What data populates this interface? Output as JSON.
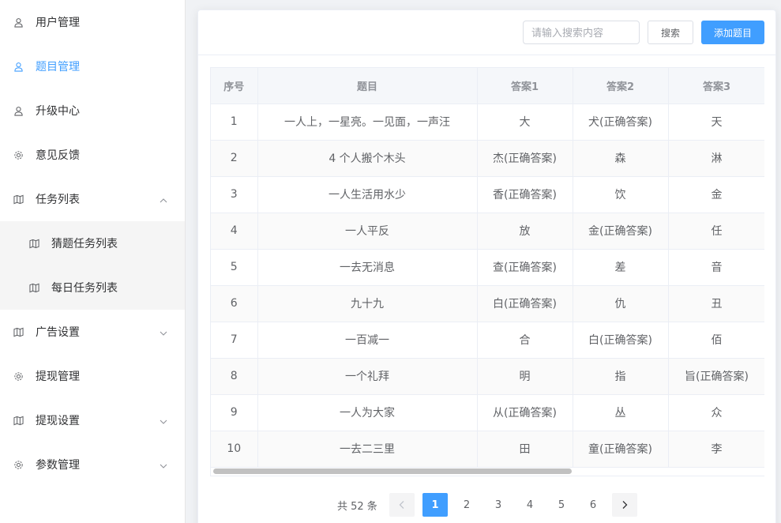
{
  "sidebar": {
    "items": [
      {
        "label": "用户管理",
        "icon": "user-icon"
      },
      {
        "label": "题目管理",
        "icon": "user-icon",
        "active": true
      },
      {
        "label": "升级中心",
        "icon": "user-icon"
      },
      {
        "label": "意见反馈",
        "icon": "gear-icon"
      },
      {
        "label": "任务列表",
        "icon": "map-icon",
        "expanded": true
      },
      {
        "label": "猜题任务列表",
        "icon": "map-icon",
        "sub": true
      },
      {
        "label": "每日任务列表",
        "icon": "map-icon",
        "sub": true
      },
      {
        "label": "广告设置",
        "icon": "map-icon",
        "collapsible": true
      },
      {
        "label": "提现管理",
        "icon": "gear-icon"
      },
      {
        "label": "提现设置",
        "icon": "map-icon",
        "collapsible": true
      },
      {
        "label": "参数管理",
        "icon": "gear-icon",
        "collapsible": true
      }
    ]
  },
  "toolbar": {
    "search_placeholder": "请输入搜索内容",
    "search_label": "搜索",
    "add_label": "添加题目"
  },
  "table": {
    "columns": [
      "序号",
      "题目",
      "答案1",
      "答案2",
      "答案3"
    ],
    "rows": [
      [
        "1",
        "一人上，一星亮。一见面，一声汪",
        "大",
        "犬(正确答案)",
        "天"
      ],
      [
        "2",
        "4 个人搬个木头",
        "杰(正确答案)",
        "森",
        "淋"
      ],
      [
        "3",
        "一人生活用水少",
        "香(正确答案)",
        "饮",
        "金"
      ],
      [
        "4",
        "一人平反",
        "放",
        "金(正确答案)",
        "任"
      ],
      [
        "5",
        "一去无消息",
        "查(正确答案)",
        "差",
        "音"
      ],
      [
        "6",
        "九十九",
        "白(正确答案)",
        "仇",
        "丑"
      ],
      [
        "7",
        "一百减一",
        "合",
        "白(正确答案)",
        "佰"
      ],
      [
        "8",
        "一个礼拜",
        "明",
        "指",
        "旨(正确答案)"
      ],
      [
        "9",
        "一人为大家",
        "从(正确答案)",
        "丛",
        "众"
      ],
      [
        "10",
        "一去二三里",
        "田",
        "童(正确答案)",
        "李"
      ]
    ]
  },
  "pagination": {
    "total_text": "共 52 条",
    "pages": [
      "1",
      "2",
      "3",
      "4",
      "5",
      "6"
    ],
    "current": "1"
  },
  "colors": {
    "accent": "#409eff",
    "sidebar_sub_bg": "#f5f5f5",
    "header_bg": "#f5f7fa"
  }
}
